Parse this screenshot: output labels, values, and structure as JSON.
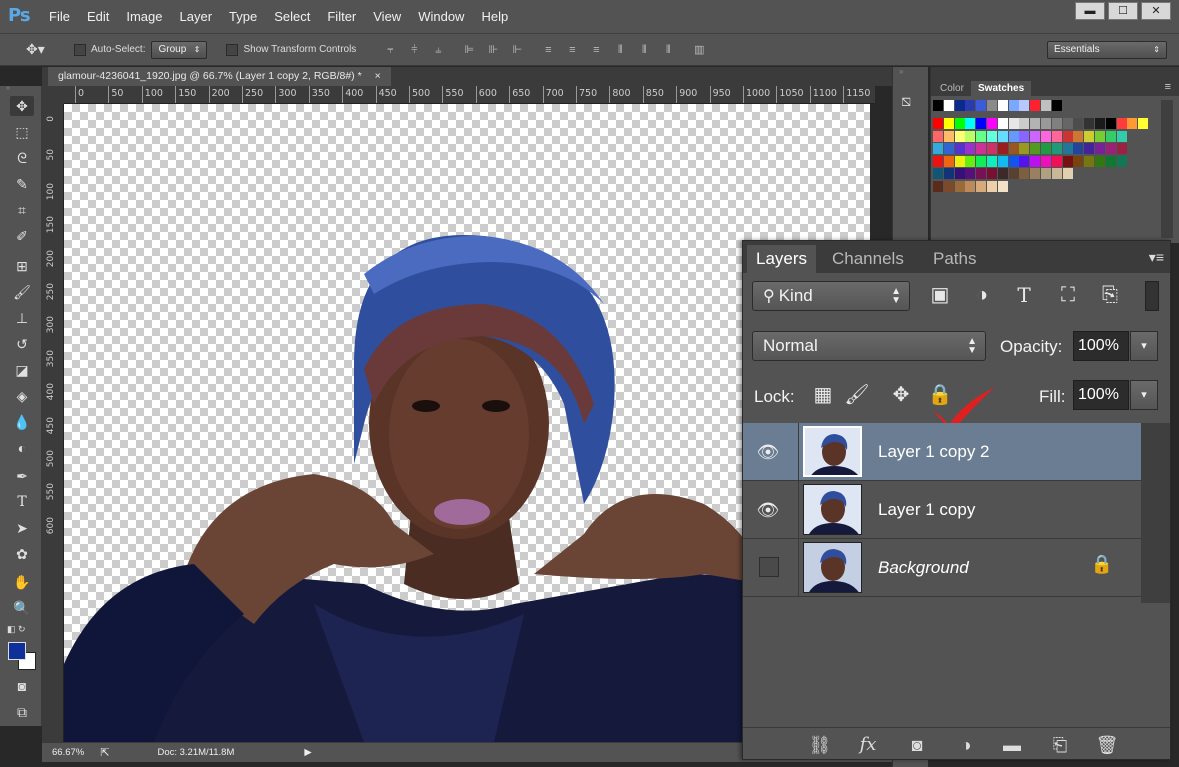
{
  "app": {
    "logo": "Ps"
  },
  "menu": [
    "File",
    "Edit",
    "Image",
    "Layer",
    "Type",
    "Select",
    "Filter",
    "View",
    "Window",
    "Help"
  ],
  "window_controls": {
    "minimize": "▬",
    "maximize": "☐",
    "close": "✕"
  },
  "options_bar": {
    "auto_select_label": "Auto-Select:",
    "auto_select_value": "Group",
    "show_transform_label": "Show Transform Controls",
    "workspace": "Essentials"
  },
  "document_tab": {
    "title": "glamour-4236041_1920.jpg @ 66.7% (Layer 1 copy 2, RGB/8#) *",
    "close": "×"
  },
  "ruler": {
    "top_ticks": [
      "0",
      "50",
      "100",
      "150",
      "200",
      "250",
      "300",
      "350",
      "400",
      "450",
      "500",
      "550",
      "600",
      "650",
      "700",
      "750",
      "800",
      "850",
      "900",
      "950",
      "1000",
      "1050",
      "1100",
      "1150"
    ],
    "left_ticks": [
      "0",
      "50",
      "100",
      "150",
      "200",
      "250",
      "300",
      "350",
      "400",
      "450",
      "500",
      "550",
      "600"
    ]
  },
  "status": {
    "zoom": "66.67%",
    "doc": "Doc: 3.21M/11.8M"
  },
  "swatches_panel": {
    "tabs": [
      "Color",
      "Swatches"
    ],
    "active_tab": "Swatches"
  },
  "layers_panel": {
    "tabs": [
      "Layers",
      "Channels",
      "Paths"
    ],
    "active_tab": "Layers",
    "filter_kind": "Kind",
    "blend_mode": "Normal",
    "opacity_label": "Opacity:",
    "opacity_value": "100%",
    "lock_label": "Lock:",
    "fill_label": "Fill:",
    "fill_value": "100%",
    "layers": [
      {
        "name": "Layer 1 copy 2",
        "visible": true,
        "selected": true,
        "locked": false
      },
      {
        "name": "Layer 1 copy",
        "visible": true,
        "selected": false,
        "locked": false
      },
      {
        "name": "Background",
        "visible": false,
        "selected": false,
        "locked": true
      }
    ]
  },
  "colors": {
    "panel_bg": "#535353",
    "dark_bg": "#3b3b3b",
    "selected_layer": "#6b7d92",
    "foreground_color": "#0f2f9a",
    "background_color": "#ffffff",
    "checkmark": "#e02020"
  },
  "swatch_colors": [
    [
      "#000000",
      "#ffffff",
      "#0b2a8e",
      "#2a3bb0",
      "#3b5bdb",
      "#8a8a8a",
      "#ffffff",
      "#7aa7ff",
      "#b8c8ff",
      "#ff2030",
      "#c0c0c0",
      "#000000"
    ],
    [
      "#ff0000",
      "#ffff00",
      "#00ff00",
      "#00ffff",
      "#0000ff",
      "#ff00ff",
      "#ffffff",
      "#e6e6e6",
      "#cccccc",
      "#b3b3b3",
      "#999999",
      "#808080",
      "#666666",
      "#4d4d4d",
      "#333333",
      "#1a1a1a",
      "#000000",
      "#ff3b3b",
      "#ff9933",
      "#ffff33"
    ],
    [
      "#ff6666",
      "#ffbb66",
      "#ffff77",
      "#bbff66",
      "#66ff88",
      "#66ffdd",
      "#66ddff",
      "#6699ff",
      "#8866ff",
      "#cc66ff",
      "#ff66dd",
      "#ff6699",
      "#cc3333",
      "#cc7733",
      "#cccc33",
      "#77cc33",
      "#33cc66",
      "#33ccaa"
    ],
    [
      "#33aadd",
      "#3366cc",
      "#5533cc",
      "#9933cc",
      "#cc3399",
      "#cc3366",
      "#991f1f",
      "#995522",
      "#999922",
      "#559922",
      "#229944",
      "#229977",
      "#227799",
      "#224499",
      "#442299",
      "#772299",
      "#992277",
      "#992244"
    ],
    [
      "#ee1111",
      "#ee6611",
      "#eeee11",
      "#66ee11",
      "#11ee55",
      "#11eebb",
      "#11bbee",
      "#1155ee",
      "#5511ee",
      "#bb11ee",
      "#ee11bb",
      "#ee1155",
      "#771111",
      "#774411",
      "#777711",
      "#337711",
      "#117733",
      "#117755"
    ],
    [
      "#115577",
      "#113377",
      "#331177",
      "#551177",
      "#771155",
      "#771133",
      "#3b2a2a",
      "#5a4030",
      "#7a6040",
      "#9a8060",
      "#b0a080",
      "#c8b898",
      "#e0d0b0"
    ],
    [
      "#5a2a1a",
      "#7a4a2a",
      "#9a6a3a",
      "#ba8a5a",
      "#d6aa7a",
      "#eed0a8",
      "#f4e2c8"
    ]
  ],
  "tools": [
    "move-tool",
    "marquee-tool",
    "lasso-tool",
    "quick-select-tool",
    "crop-tool",
    "eyedropper-tool",
    "healing-tool",
    "brush-tool",
    "stamp-tool",
    "history-brush-tool",
    "eraser-tool",
    "paint-bucket-tool",
    "blur-tool",
    "dodge-tool",
    "pen-tool",
    "type-tool",
    "path-select-tool",
    "shape-tool",
    "hand-tool",
    "zoom-tool"
  ]
}
